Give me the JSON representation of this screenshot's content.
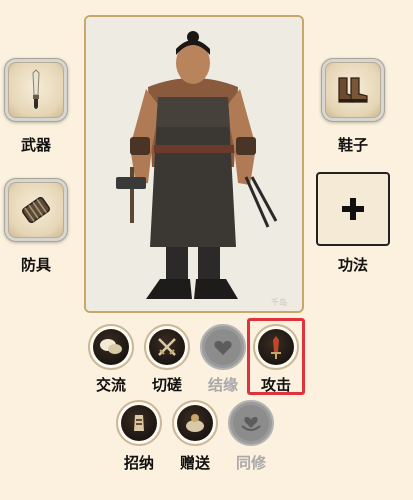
{
  "equipment": {
    "weapon": {
      "label": "武器",
      "icon": "knife-icon"
    },
    "armor": {
      "label": "防具",
      "icon": "bracer-icon"
    },
    "shoes": {
      "label": "鞋子",
      "icon": "boots-icon"
    },
    "skill": {
      "label": "功法",
      "icon": "plus-icon"
    }
  },
  "portrait": {
    "watermark": "千岛"
  },
  "actions": [
    {
      "label": "交流",
      "icon": "chat-bubbles-icon",
      "enabled": true
    },
    {
      "label": "切磋",
      "icon": "crossed-swords-icon",
      "enabled": true
    },
    {
      "label": "结缘",
      "icon": "bond-icon",
      "enabled": false
    },
    {
      "label": "攻击",
      "icon": "sword-icon",
      "enabled": true,
      "highlighted": true
    },
    {
      "label": "招纳",
      "icon": "recruit-icon",
      "enabled": true
    },
    {
      "label": "赠送",
      "icon": "gift-icon",
      "enabled": true
    },
    {
      "label": "同修",
      "icon": "heart-hands-icon",
      "enabled": false
    }
  ],
  "colors": {
    "background": "#fbf1de",
    "highlight": "#e0323a",
    "disabled": "#9a9a9a"
  }
}
